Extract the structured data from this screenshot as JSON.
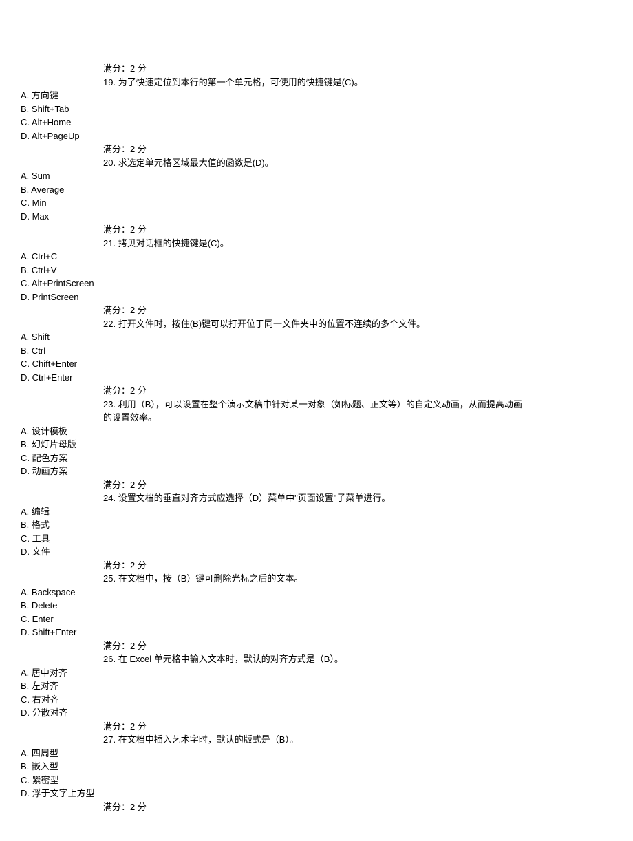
{
  "score_label": "满分：2  分",
  "questions": [
    {
      "num": "19.",
      "text": "为了快速定位到本行的第一个单元格，可使用的快捷键是(C)。",
      "options": [
        "A. 方向键",
        "B. Shift+Tab",
        "C. Alt+Home",
        "D. Alt+PageUp"
      ]
    },
    {
      "num": "20.",
      "text": "求选定单元格区域最大值的函数是(D)。",
      "options": [
        "A. Sum",
        "B. Average",
        "C. Min",
        "D. Max"
      ]
    },
    {
      "num": "21.",
      "text": "拷贝对话框的快捷键是(C)。",
      "options": [
        "A. Ctrl+C",
        "B. Ctrl+V",
        "C. Alt+PrintScreen",
        "D. PrintScreen"
      ]
    },
    {
      "num": "22.",
      "text": "打开文件时，按住(B)键可以打开位于同一文件夹中的位置不连续的多个文件。",
      "options": [
        "A. Shift",
        "B. Ctrl",
        "C. Chift+Enter",
        "D. Ctrl+Enter"
      ]
    },
    {
      "num": "23.",
      "text": "利用（B），可以设置在整个演示文稿中针对某一对象（如标题、正文等）的自定义动画，从而提高动画",
      "text_cont": "的设置效率。",
      "options": [
        "A. 设计模板",
        "B. 幻灯片母版",
        "C. 配色方案",
        "D. 动画方案"
      ]
    },
    {
      "num": "24.",
      "text": "设置文档的垂直对齐方式应选择（D）菜单中\"页面设置\"子菜单进行。",
      "options": [
        "A. 编辑",
        "B. 格式",
        "C. 工具",
        "D. 文件"
      ]
    },
    {
      "num": "25.",
      "text": "在文档中，按（B）键可删除光标之后的文本。",
      "options": [
        "A. Backspace",
        "B. Delete",
        "C. Enter",
        "D. Shift+Enter"
      ]
    },
    {
      "num": "26.",
      "text": "在 Excel 单元格中输入文本时，默认的对齐方式是（B）。",
      "options": [
        "A. 居中对齐",
        "B. 左对齐",
        "C. 右对齐",
        "D. 分散对齐"
      ]
    },
    {
      "num": "27.",
      "text": "在文档中插入艺术字时，默认的版式是（B）。",
      "options": [
        "A. 四周型",
        "B. 嵌入型",
        "C. 紧密型",
        "D. 浮于文字上方型"
      ]
    }
  ]
}
